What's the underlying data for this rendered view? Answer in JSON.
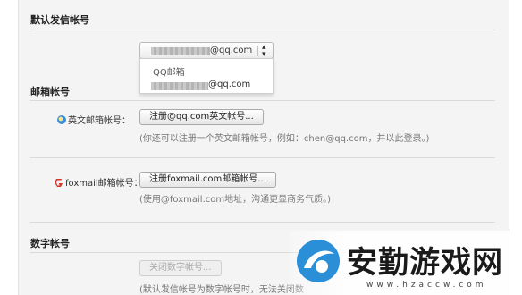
{
  "sections": {
    "default_sender": "默认发信帐号",
    "mailbox_accounts": "邮箱帐号",
    "digital_account": "数字帐号"
  },
  "sender_select": {
    "value": "@qq.com",
    "dropdown_group": "QQ邮箱",
    "option": "@qq.com"
  },
  "english_account": {
    "label": "英文邮箱帐号：",
    "button": "注册@qq.com英文帐号...",
    "hint": "(你还可以注册一个英文邮箱帐号，例如：chen@qq.com，并以此登录。)"
  },
  "foxmail_account": {
    "label": "foxmail邮箱帐号：",
    "button": "注册foxmail.com邮箱帐号...",
    "hint": "(使用@foxmail.com地址，沟通更显商务气质。)"
  },
  "digital": {
    "button": "关闭数字帐号...",
    "hint": "(默认发信帐号为数字帐号时，无法关闭数"
  },
  "watermark": {
    "text": "安勤游戏网",
    "url": "www.hzaccw.com"
  },
  "icons": {
    "english_mail": "qq-mail-icon",
    "foxmail": "foxmail-icon",
    "select_arrow": "updown-arrow-icon"
  }
}
